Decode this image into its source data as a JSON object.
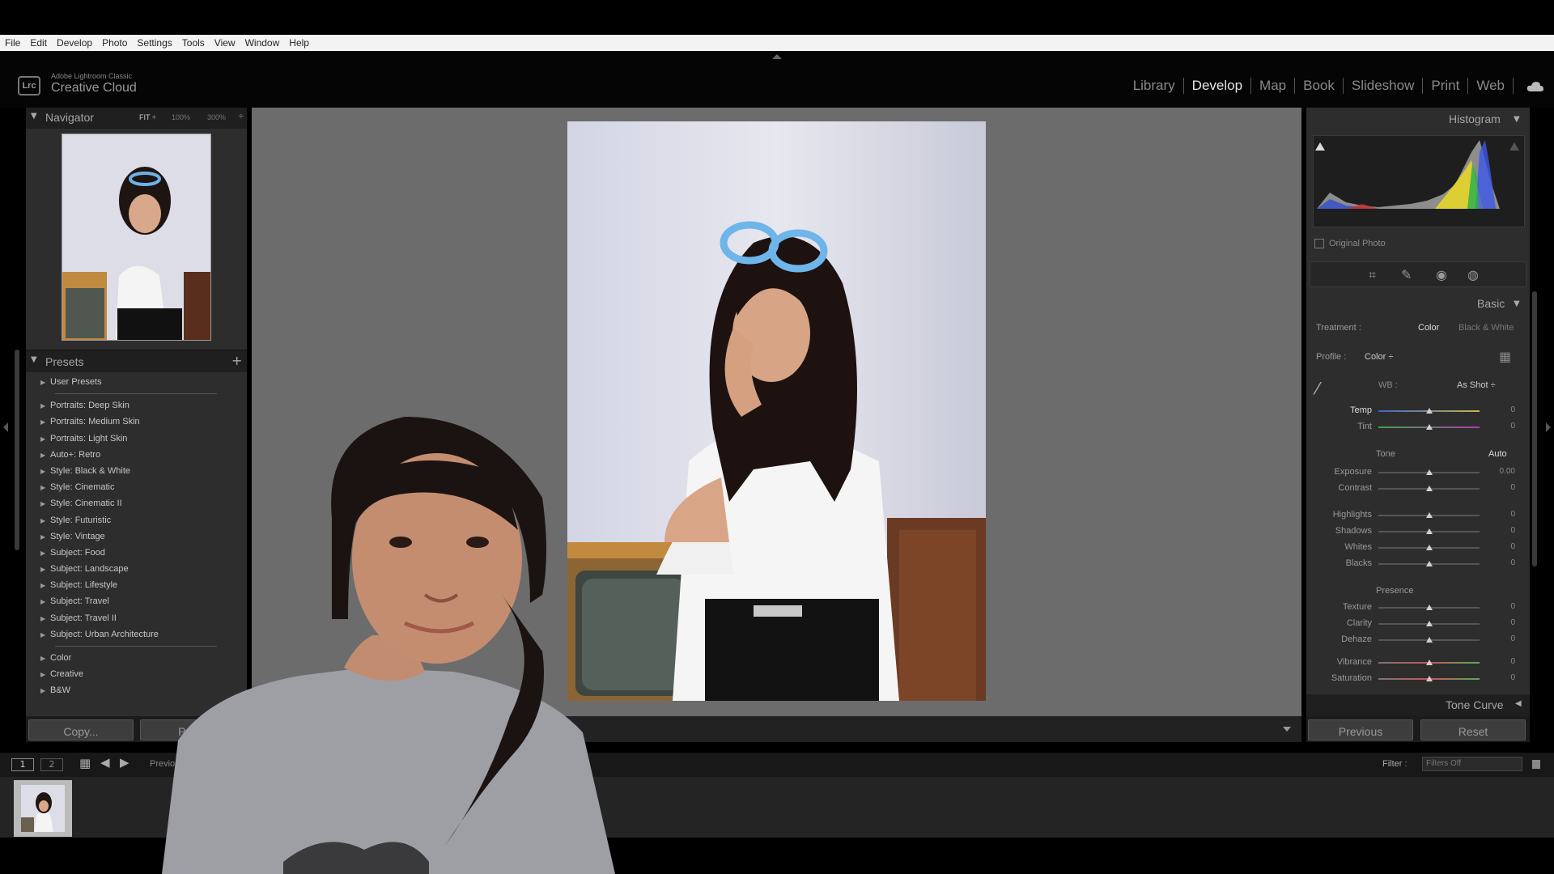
{
  "menu": [
    "File",
    "Edit",
    "Develop",
    "Photo",
    "Settings",
    "Tools",
    "View",
    "Window",
    "Help"
  ],
  "app": {
    "subtitle": "Adobe Lightroom Classic",
    "title": "Creative Cloud",
    "badge": "Lrc"
  },
  "modules": [
    "Library",
    "Develop",
    "Map",
    "Book",
    "Slideshow",
    "Print",
    "Web"
  ],
  "active_module": "Develop",
  "navigator": {
    "title": "Navigator",
    "zoom_fit": "FIT ÷",
    "zoom_100": "100%",
    "zoom_300": "300%"
  },
  "presets": {
    "title": "Presets",
    "add": "+",
    "user": "User Presets",
    "groups": [
      "Portraits: Deep Skin",
      "Portraits: Medium Skin",
      "Portraits: Light Skin",
      "Auto+: Retro",
      "Style: Black & White",
      "Style: Cinematic",
      "Style: Cinematic II",
      "Style: Futuristic",
      "Style: Vintage",
      "Subject: Food",
      "Subject: Landscape",
      "Subject: Lifestyle",
      "Subject: Travel",
      "Subject: Travel II",
      "Subject: Urban Architecture"
    ],
    "extra": [
      "Color",
      "Creative",
      "B&W"
    ]
  },
  "left_buttons": {
    "copy": "Copy...",
    "paste": "Paste"
  },
  "histogram": {
    "title": "Histogram",
    "original": "Original Photo"
  },
  "basic": {
    "title": "Basic",
    "treatment_label": "Treatment :",
    "treatment_color": "Color",
    "treatment_bw": "Black & White",
    "profile_label": "Profile :",
    "profile_value": "Color ÷",
    "wb_label": "WB :",
    "wb_value": "As Shot ÷",
    "tone_label": "Tone",
    "auto": "Auto",
    "presence_label": "Presence",
    "sliders": [
      {
        "label": "Temp",
        "value": "0",
        "pos": 0.5
      },
      {
        "label": "Tint",
        "value": "0",
        "pos": 0.5
      },
      {
        "label": "Exposure",
        "value": "0.00",
        "pos": 0.5
      },
      {
        "label": "Contrast",
        "value": "0",
        "pos": 0.5
      },
      {
        "label": "Highlights",
        "value": "0",
        "pos": 0.5
      },
      {
        "label": "Shadows",
        "value": "0",
        "pos": 0.5
      },
      {
        "label": "Whites",
        "value": "0",
        "pos": 0.5
      },
      {
        "label": "Blacks",
        "value": "0",
        "pos": 0.5
      },
      {
        "label": "Texture",
        "value": "0",
        "pos": 0.5
      },
      {
        "label": "Clarity",
        "value": "0",
        "pos": 0.5
      },
      {
        "label": "Dehaze",
        "value": "0",
        "pos": 0.5
      },
      {
        "label": "Vibrance",
        "value": "0",
        "pos": 0.5
      },
      {
        "label": "Saturation",
        "value": "0",
        "pos": 0.5
      }
    ]
  },
  "tone_curve": "Tone Curve",
  "right_buttons": {
    "previous": "Previous",
    "reset": "Reset"
  },
  "filmstrip": {
    "screen1": "1",
    "screen2": "2",
    "prev_label": "Previous",
    "filter_label": "Filter :",
    "filter_value": "Filters Off"
  },
  "colors": {
    "accent": "#e6e6e6",
    "panel": "#2d2d2d",
    "canvas": "#6c6c6d"
  }
}
